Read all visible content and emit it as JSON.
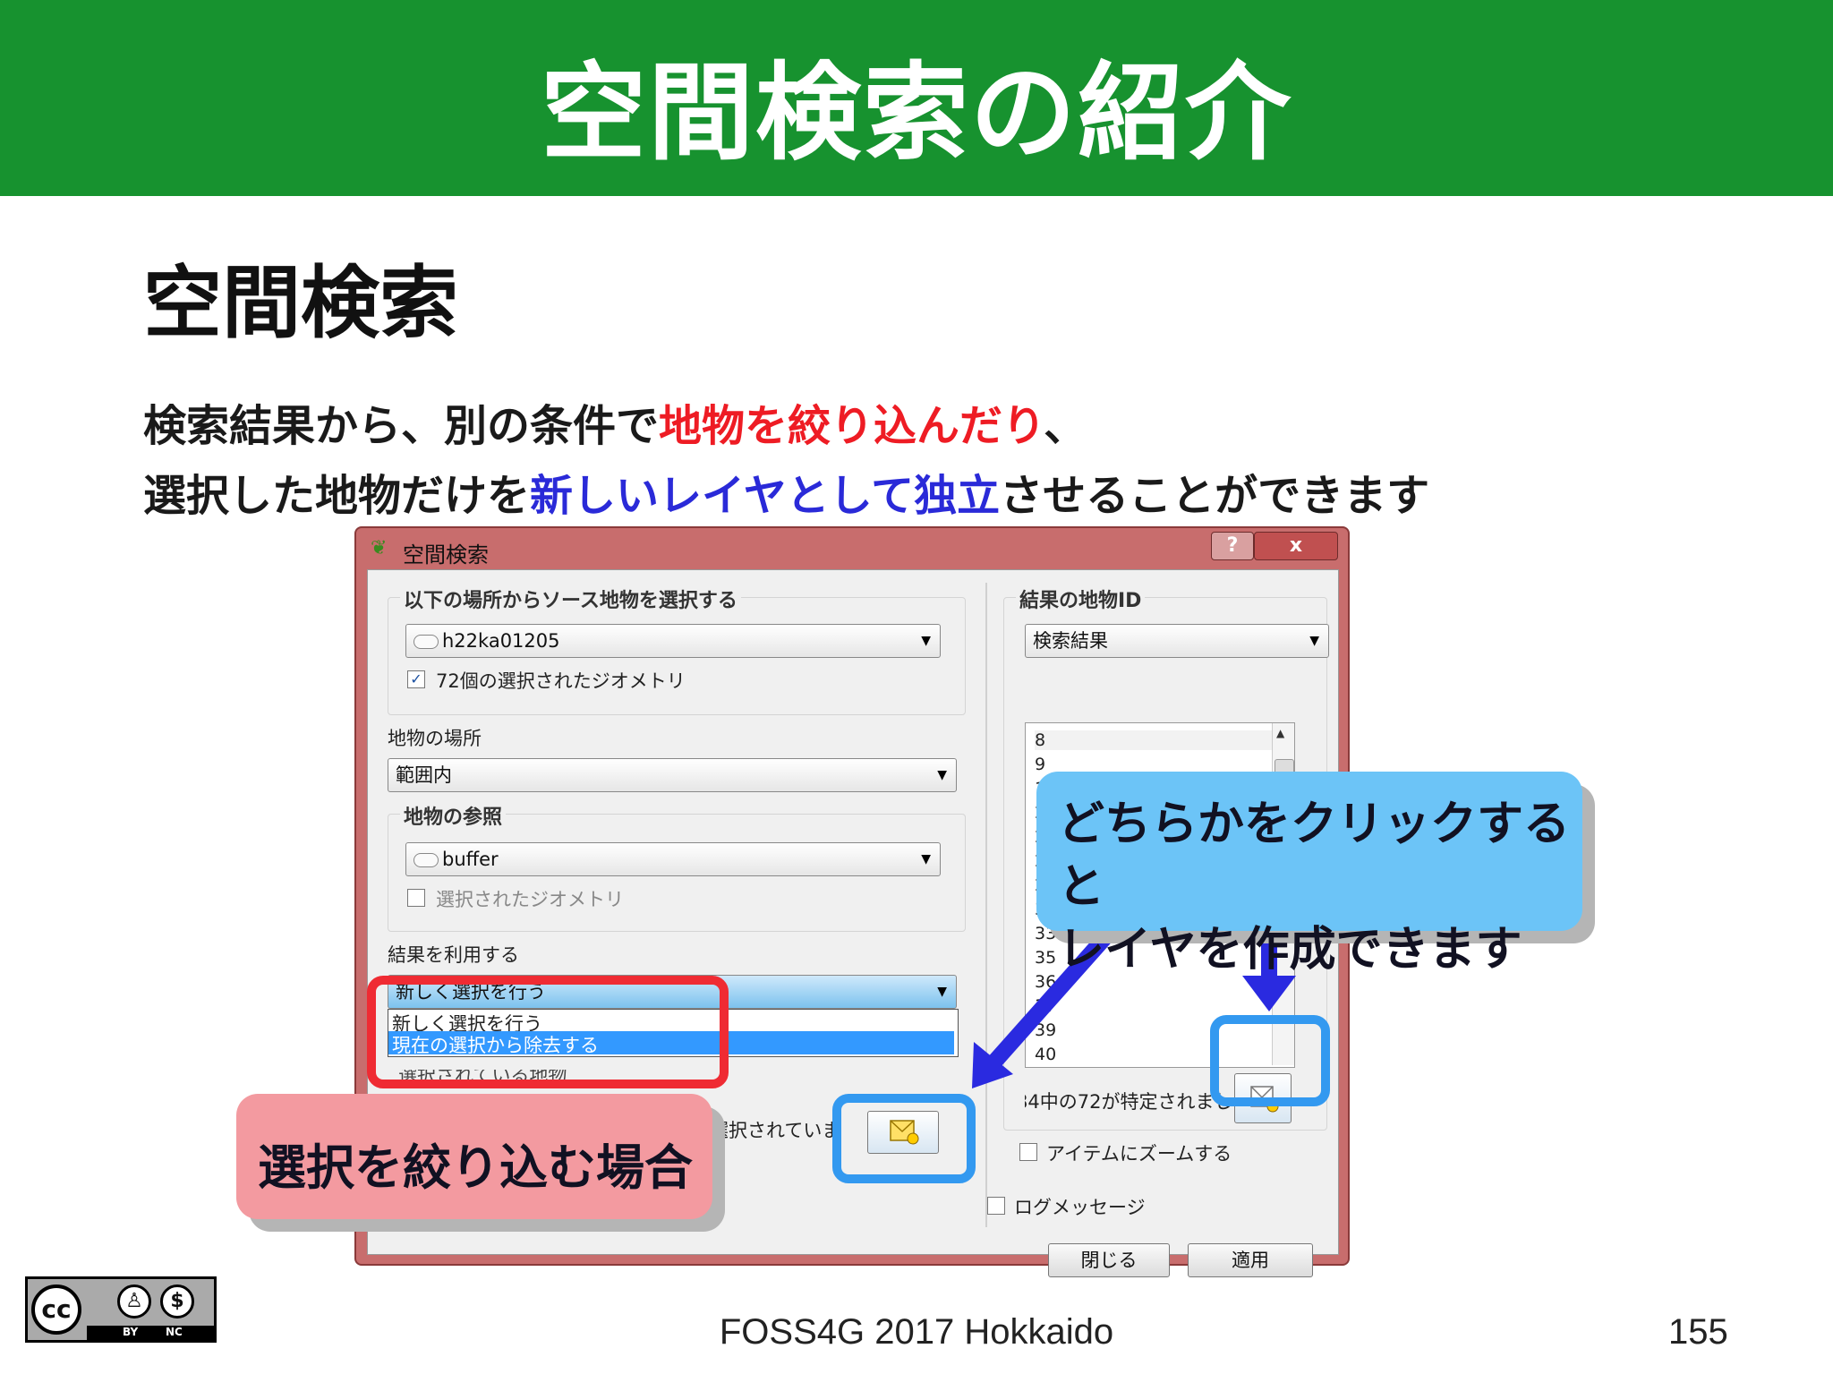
{
  "slide": {
    "title": "空間検索の紹介",
    "heading": "空間検索",
    "line1": {
      "a": "検索結果から、別の条件で",
      "b": "地物を絞り込んだり",
      "c": "、"
    },
    "line2": {
      "a": "選択した地物だけを",
      "b": "新しいレイヤとして独立",
      "c": "させることができます"
    },
    "footer": "FOSS4G 2017 Hokkaido",
    "page_number": "155",
    "license_badge": {
      "cc": "cc",
      "by": "BY",
      "nc": "NC"
    }
  },
  "dialog": {
    "title": "空間検索",
    "help_btn": "?",
    "close_btn": "x",
    "source_group_label": "以下の場所からソース地物を選択する",
    "source_layer": "h22ka01205",
    "source_selected_checkbox": "72個の選択されたジオメトリ",
    "where_label": "地物の場所",
    "where_value": "範囲内",
    "ref_group_label": "地物の参照",
    "ref_layer": "buffer",
    "ref_selected_checkbox": "選択されたジオメトリ",
    "use_result_label": "結果を利用する",
    "use_result_value": "新しく選択を行う",
    "dropdown_options": [
      "新しく選択を行う",
      "現在の選択から除去する"
    ],
    "hidden_label_fragment": "選択されている地物",
    "selected_text": "選択されていま",
    "result_group_label": "結果の地物ID",
    "result_combo": "検索結果",
    "result_ids": [
      "8",
      "9",
      "10",
      "20",
      "21",
      "23",
      "28",
      "30",
      "33",
      "35",
      "36",
      "37",
      "39",
      "40"
    ],
    "status_text": "84中の72が特定されまし",
    "zoom_checkbox": "アイテムにズームする",
    "log_checkbox": "ログメッセージ",
    "close_button": "閉じる",
    "apply_button": "適用"
  },
  "callouts": {
    "blue_line1": "どちらかをクリックすると",
    "blue_line2": "レイヤを作成できます",
    "red": "選択を絞り込む場合"
  },
  "colors": {
    "banner": "#17922f",
    "accent_red": "#ee1c24",
    "accent_blue": "#2a2ad8",
    "callout_blue": "#6cc4f7",
    "callout_red": "#f39aa0",
    "arrow": "#2a2ae0"
  }
}
